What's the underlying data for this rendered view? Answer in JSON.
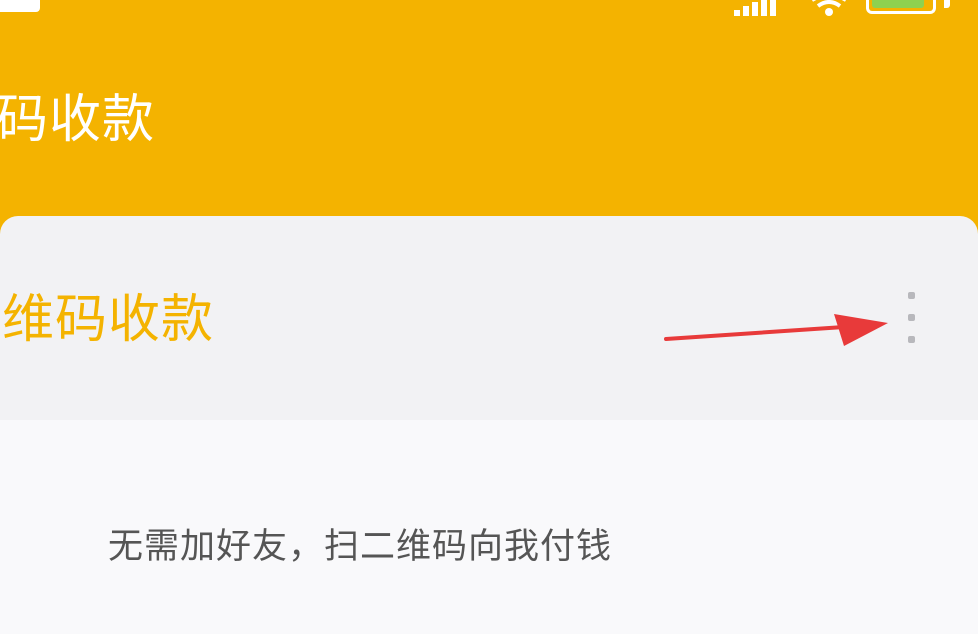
{
  "status_bar": {
    "battery_level": "77"
  },
  "header": {
    "title": "码收款"
  },
  "card": {
    "title": "维码收款"
  },
  "content": {
    "subtitle": "无需加好友，扫二维码向我付钱"
  },
  "colors": {
    "brand": "#f4b300",
    "annotation": "#e83a3a"
  },
  "icons": {
    "message": "message-icon",
    "signal": "signal-icon",
    "wifi": "wifi-icon",
    "battery": "battery-icon",
    "more": "more-vertical-icon",
    "arrow": "red-arrow-annotation"
  }
}
